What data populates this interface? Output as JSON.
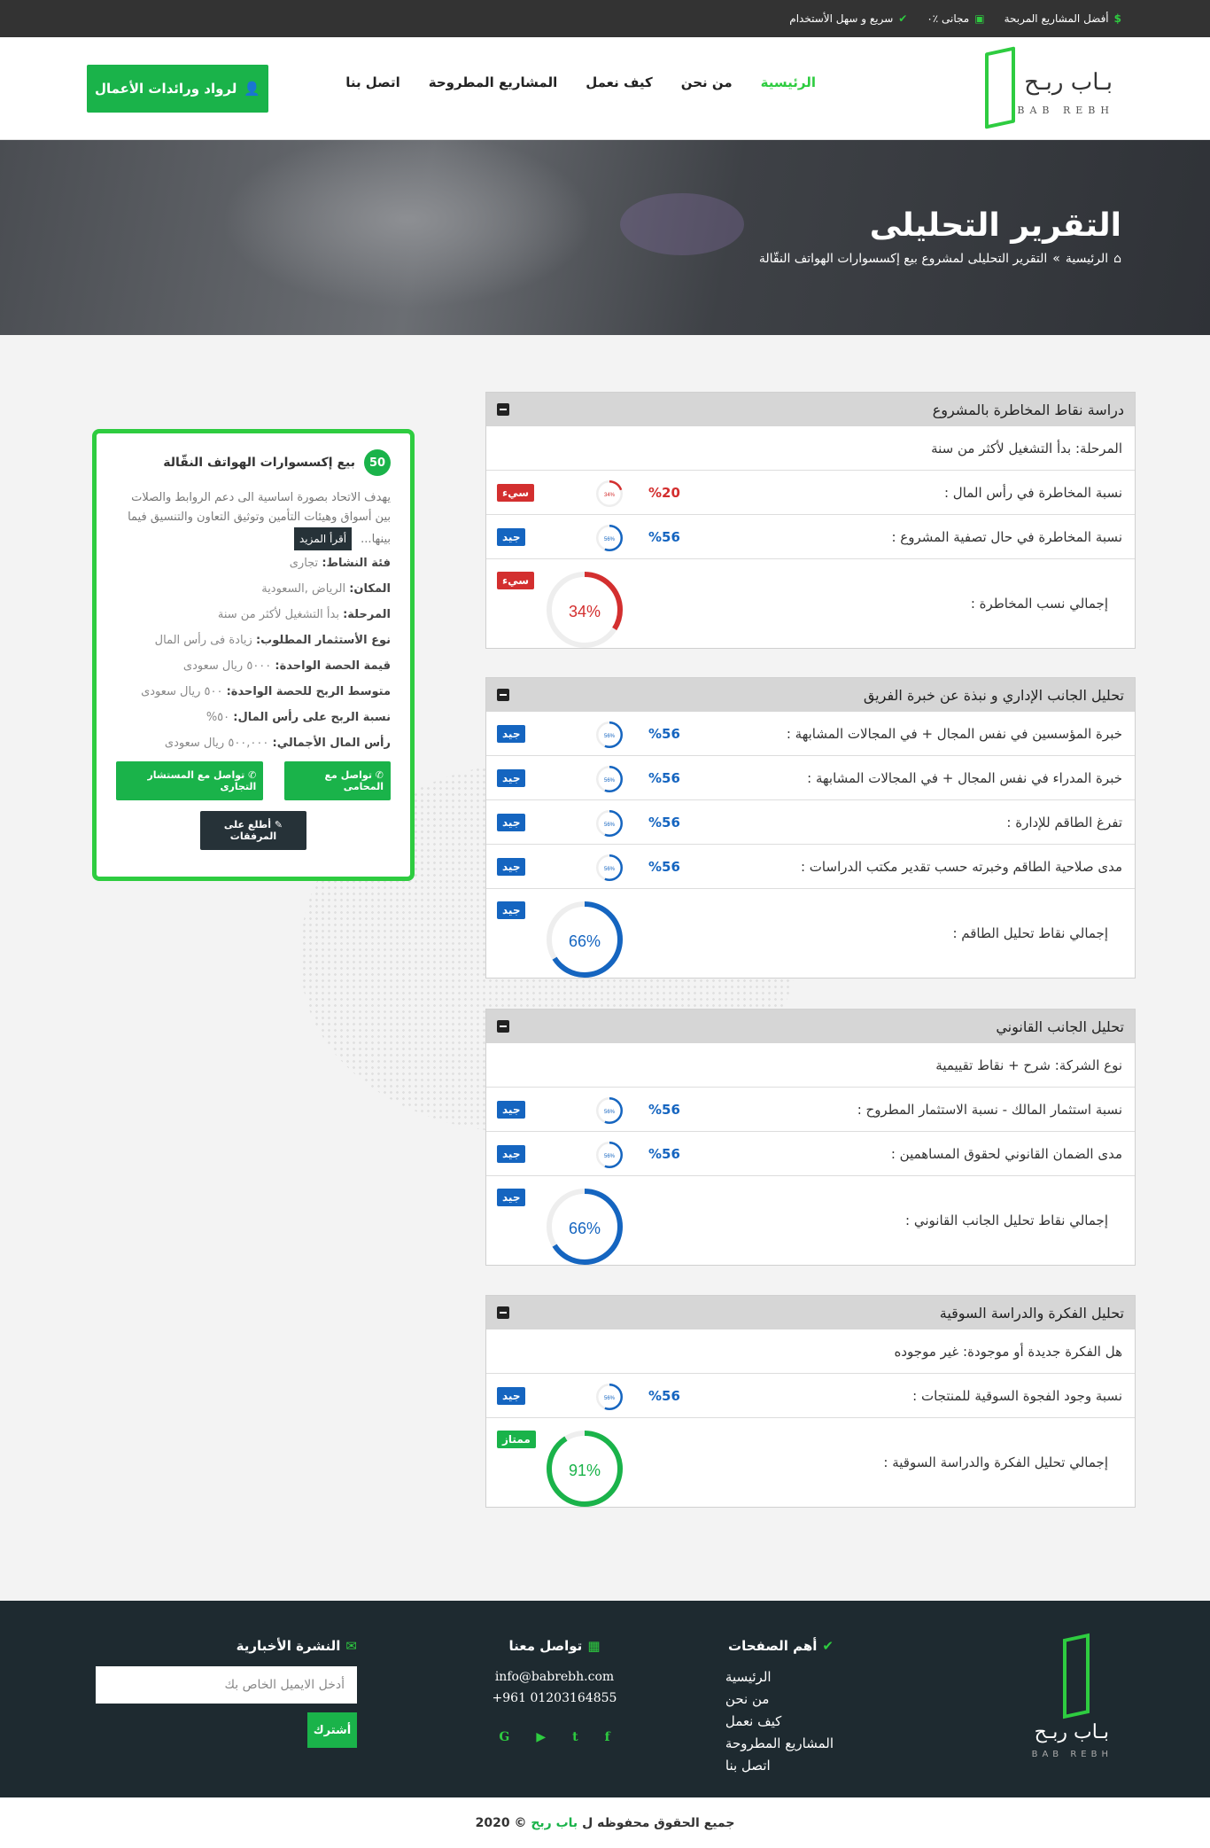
{
  "topbar": {
    "items": [
      {
        "icon": "dollar-icon",
        "text": "أفضل المشاريع المربحة"
      },
      {
        "icon": "money-icon",
        "text": "مجانى ٪٠"
      },
      {
        "icon": "check-circle-icon",
        "text": "سريع و سهل الأستخدام"
      }
    ]
  },
  "logo": {
    "name": "بـاب ربـح",
    "sub": "BAB REBH"
  },
  "nav": {
    "items": [
      "الرئيسية",
      "من نحن",
      "كيف نعمل",
      "المشاريع المطروحة",
      "اتصل بنا"
    ]
  },
  "cta": {
    "label": "لرواد ورائدات الأعمال"
  },
  "hero": {
    "title": "التقرير التحليلى",
    "crumb_home": "الرئيسية",
    "crumb_sep": "»",
    "crumb_current": "التقرير التحليلى لمشروع بيع إكسسوارات الهواتف النقّالة"
  },
  "panels": [
    {
      "title": "دراسة نقاط المخاطرة بالمشروع",
      "rows": [
        {
          "label": "المرحلة: بدأ التشغيل لأكثر من سنة"
        },
        {
          "label": "نسبة المخاطرة في رأس المال :",
          "pct": "%20",
          "ring": "34%",
          "badge": "سيء",
          "status": "bad",
          "value": 0.2
        },
        {
          "label": "نسبة المخاطرة في حال تصفية المشروع :",
          "pct": "%56",
          "ring": "56%",
          "badge": "جيد",
          "status": "good",
          "value": 0.56
        }
      ],
      "total": {
        "label": "إجمالي نسب المخاطرة :",
        "value_text": "34%",
        "value": 0.34,
        "badge": "سيء",
        "status": "bad"
      }
    },
    {
      "title": "تحليل الجانب الإداري و نبذة عن خبرة الفريق",
      "rows": [
        {
          "label": "خبرة المؤسسين في نفس المجال + في المجالات المشابهة :",
          "pct": "%56",
          "ring": "56%",
          "badge": "جيد",
          "status": "good",
          "value": 0.56
        },
        {
          "label": "خبرة المدراء في نفس المجال + في المجالات المشابهة :",
          "pct": "%56",
          "ring": "56%",
          "badge": "جيد",
          "status": "good",
          "value": 0.56
        },
        {
          "label": "تفرغ الطاقم للإدارة :",
          "pct": "%56",
          "ring": "56%",
          "badge": "جيد",
          "status": "good",
          "value": 0.56
        },
        {
          "label": "مدى صلاحية الطاقم وخبرته حسب تقدير مكتب الدراسات :",
          "pct": "%56",
          "ring": "56%",
          "badge": "جيد",
          "status": "good",
          "value": 0.56
        }
      ],
      "total": {
        "label": "إجمالي نقاط تحليل الطاقم :",
        "value_text": "66%",
        "value": 0.66,
        "badge": "جيد",
        "status": "good"
      }
    },
    {
      "title": "تحليل الجانب القانوني",
      "rows": [
        {
          "label": "نوع الشركة: شرح + نقاط تقييمية"
        },
        {
          "label": "نسبة استثمار المالك - نسبة الاستثمار المطروح :",
          "pct": "%56",
          "ring": "56%",
          "badge": "جيد",
          "status": "good",
          "value": 0.56
        },
        {
          "label": "مدى الضمان القانوني لحقوق المساهمين :",
          "pct": "%56",
          "ring": "56%",
          "badge": "جيد",
          "status": "good",
          "value": 0.56
        }
      ],
      "total": {
        "label": "إجمالي نقاط تحليل الجانب القانوني :",
        "value_text": "66%",
        "value": 0.66,
        "badge": "جيد",
        "status": "good"
      }
    },
    {
      "title": "تحليل الفكرة والدراسة السوقية",
      "rows": [
        {
          "label": "هل الفكرة جديدة أو موجودة: غير موجوده"
        },
        {
          "label": "نسبة وجود الفجوة السوقية للمنتجات :",
          "pct": "%56",
          "ring": "56%",
          "badge": "جيد",
          "status": "good",
          "value": 0.56
        }
      ],
      "total": {
        "label": "إجمالي تحليل الفكرة والدراسة السوقية :",
        "value_text": "91%",
        "value": 0.91,
        "badge": "ممتاز",
        "status": "excellent"
      }
    }
  ],
  "card": {
    "num": "50",
    "title": "بيع إكسسوارات الهواتف النقّالة",
    "desc": "يهدف الاتحاد بصورة اساسية الى دعم الروابط والصلات بين أسواق وهيئات التأمين وتوثيق التعاون والتنسيق فيما بينها...",
    "more": "أقرأ المزيد",
    "fields": [
      {
        "k": "فئة النشاط:",
        "v": "تجارى"
      },
      {
        "k": "المكان:",
        "v": "الرياض ,السعودية"
      },
      {
        "k": "المرحلة:",
        "v": "بدأ التشغيل لأكثر من سنة"
      },
      {
        "k": "نوع الأستثمار المطلوب:",
        "v": "زيادة فى رأس المال"
      },
      {
        "k": "قيمة الحصة الواحدة:",
        "v": "٥٠٠٠ ريال سعودى"
      },
      {
        "k": "متوسط الربح للحصة الواحدة:",
        "v": "٥٠٠ ريال سعودى"
      },
      {
        "k": "نسبة الربح على رأس المال:",
        "v": "٥٠%"
      },
      {
        "k": "رأس المال الأجمالي:",
        "v": "٥٠٠,٠٠٠ ريال سعودى"
      }
    ],
    "btn_lawyer": "تواصل مع المحامى",
    "btn_advisor": "تواصل مع المستشار التجارى",
    "btn_attach": "أطلع على المرفقات"
  },
  "footer": {
    "pages_title": "أهم الصفحات",
    "pages": [
      "الرئيسية",
      "من نحن",
      "كيف نعمل",
      "المشاريع المطروحة",
      "اتصل بنا"
    ],
    "contact_title": "تواصل معنا",
    "email": "info@babrebh.com",
    "phone": "+961 01203164855",
    "social": [
      "facebook-icon",
      "twitter-icon",
      "youtube-icon",
      "google-icon"
    ],
    "newsletter_title": "النشرة الأخبارية",
    "email_placeholder": "أدخل الايميل الخاص بك",
    "subscribe": "أشترك"
  },
  "copyright": {
    "pre": "جميع الحقوق محفوظه ل",
    "brand": "باب ربح",
    "year": "© 2020"
  },
  "colors": {
    "good": "#1565c0",
    "bad": "#d32f2f",
    "excellent": "#1ab34a",
    "accent": "#2ecc40"
  }
}
